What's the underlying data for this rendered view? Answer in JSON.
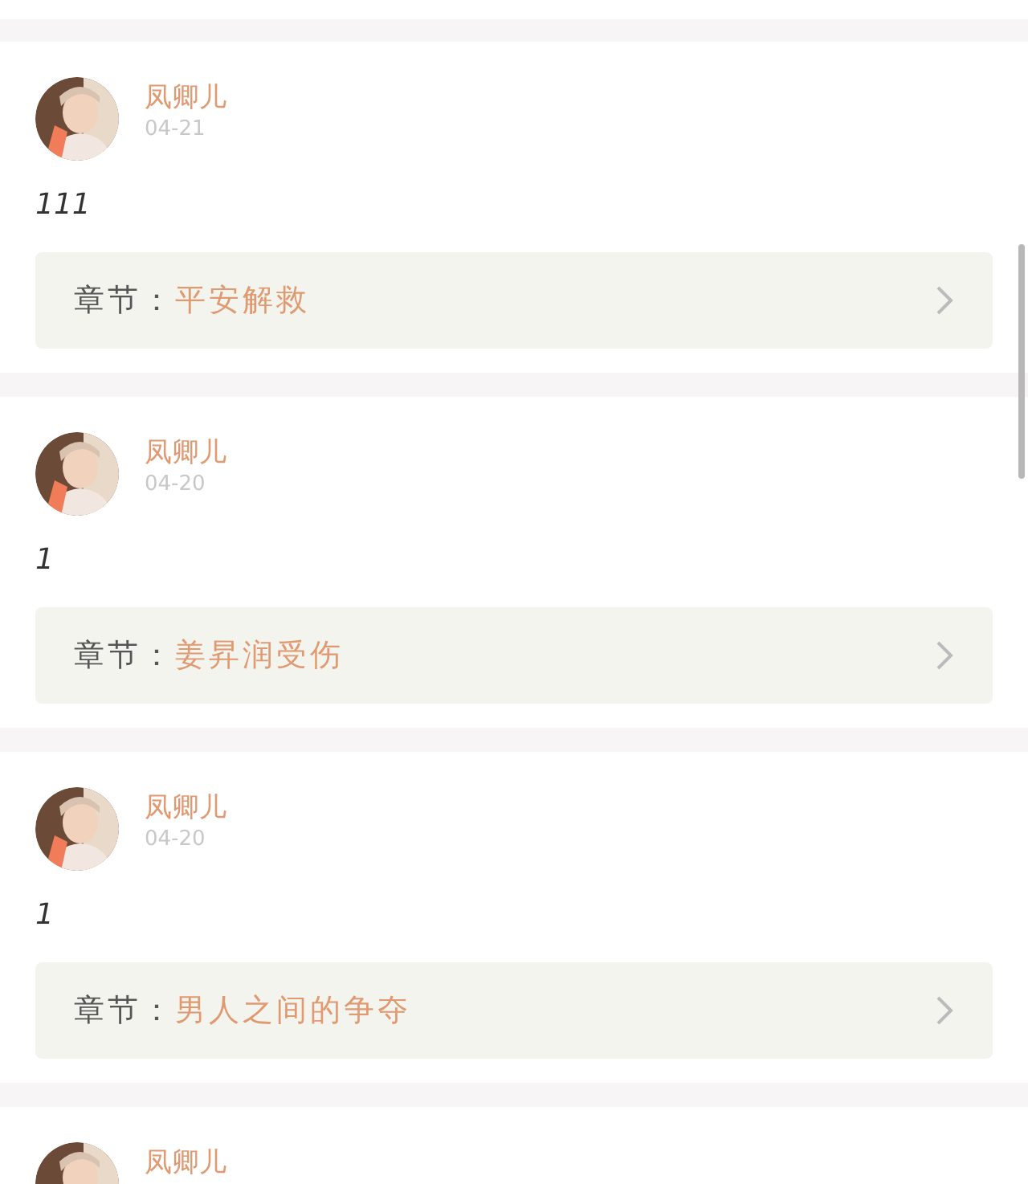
{
  "comments": [
    {
      "user": "凤卿儿",
      "date": "04-21",
      "text": "111",
      "chapter_label": "章节：",
      "chapter": "平安解救"
    },
    {
      "user": "凤卿儿",
      "date": "04-20",
      "text": "1",
      "chapter_label": "章节：",
      "chapter": "姜昇润受伤"
    },
    {
      "user": "凤卿儿",
      "date": "04-20",
      "text": "1",
      "chapter_label": "章节：",
      "chapter": "男人之间的争夺"
    },
    {
      "user": "凤卿儿"
    }
  ]
}
